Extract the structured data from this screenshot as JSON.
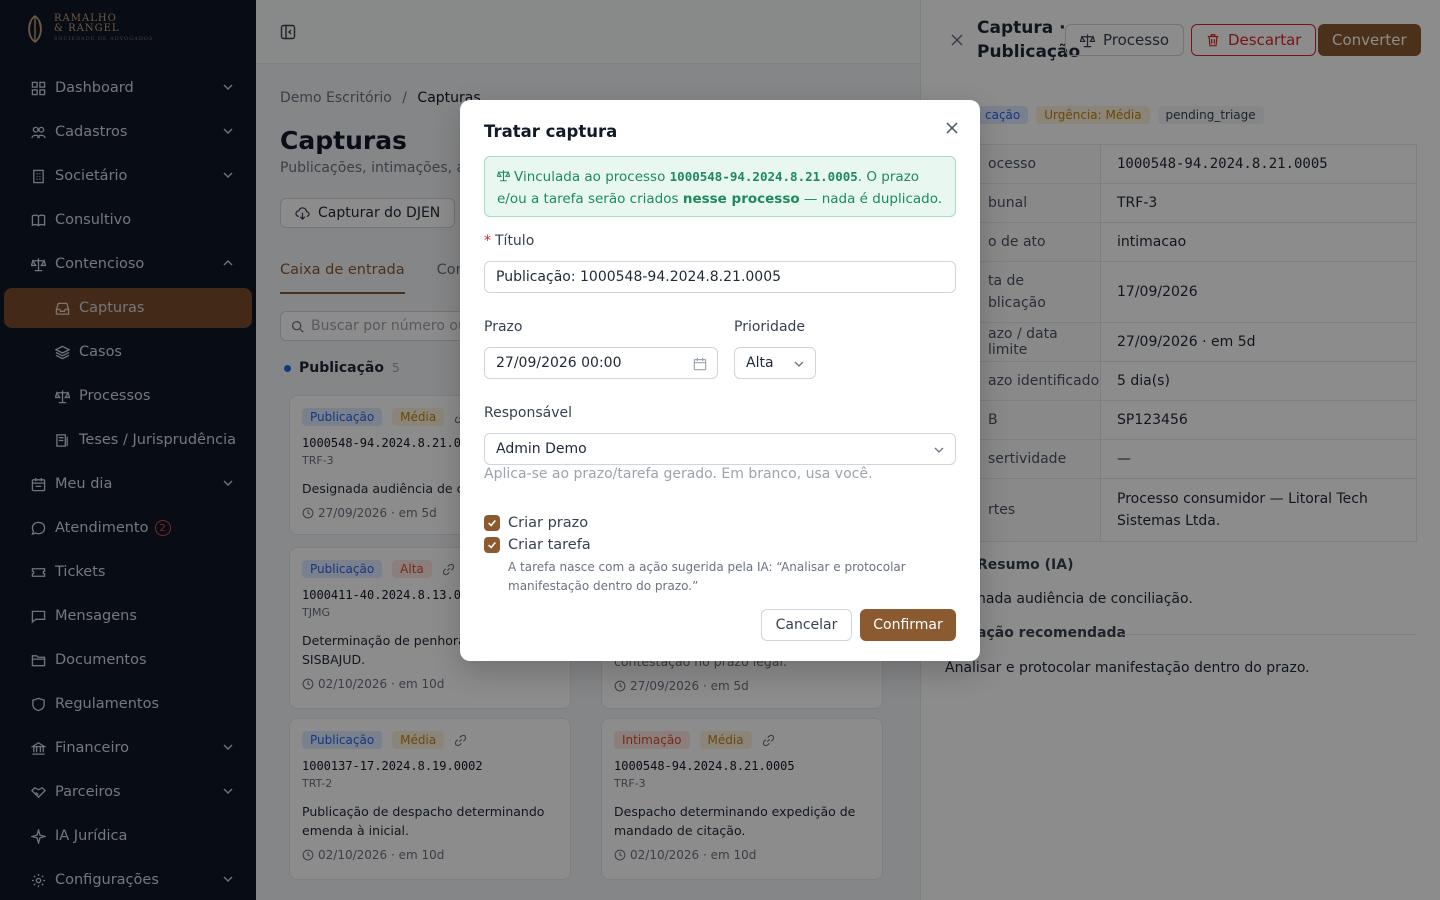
{
  "brand": {
    "name_line1": "RAMALHO",
    "name_line2": "& RANGEL",
    "tagline": "SOCIEDADE DE ADVOGADOS",
    "accent": "#8b5a30"
  },
  "sidebar": {
    "items": [
      {
        "label": "Dashboard",
        "icon": "grid-icon"
      },
      {
        "label": "Cadastros",
        "icon": "users-icon"
      },
      {
        "label": "Societário",
        "icon": "building-icon"
      },
      {
        "label": "Consultivo",
        "icon": "book-icon"
      },
      {
        "label": "Contencioso",
        "icon": "scale-icon"
      },
      {
        "label": "Capturas",
        "icon": "inbox-icon"
      },
      {
        "label": "Casos",
        "icon": "layers-icon"
      },
      {
        "label": "Processos",
        "icon": "scale-icon"
      },
      {
        "label": "Teses / Jurisprudência",
        "icon": "library-icon"
      },
      {
        "label": "Meu dia",
        "icon": "calendar-icon"
      },
      {
        "label": "Atendimento",
        "icon": "chat-icon",
        "badge": "2"
      },
      {
        "label": "Tickets",
        "icon": "ticket-icon"
      },
      {
        "label": "Mensagens",
        "icon": "message-icon"
      },
      {
        "label": "Documentos",
        "icon": "folder-icon"
      },
      {
        "label": "Regulamentos",
        "icon": "shield-icon"
      },
      {
        "label": "Financeiro",
        "icon": "bank-icon"
      },
      {
        "label": "Parceiros",
        "icon": "handshake-icon"
      },
      {
        "label": "IA Jurídica",
        "icon": "sparkle-icon"
      },
      {
        "label": "Configurações",
        "icon": "gear-icon"
      }
    ]
  },
  "main": {
    "breadcrumb": {
      "root": "Demo Escritório",
      "sep": "/",
      "current": "Capturas"
    },
    "title": "Capturas",
    "subtitle": "Publicações, intimações, ar",
    "capture_button": "Capturar do DJEN",
    "tabs": [
      {
        "label": "Caixa de entrada"
      },
      {
        "label": "Conf"
      }
    ],
    "search_placeholder": "Buscar por número ou",
    "group": {
      "label": "Publicação",
      "count": "5"
    },
    "cards": [
      {
        "type": "Publicação",
        "urgency": "Média",
        "number": "1000548-94.2024.8.21.0",
        "court": "TRF-3",
        "desc": "Designada audiência de co",
        "due": "27/09/2026 · em 5d"
      },
      {
        "type": "Publicação",
        "urgency": "Alta",
        "number": "1000411-40.2024.8.13.0",
        "court": "TJMG",
        "desc": "Determinação de penhora",
        "desc2": "SISBAJUD.",
        "due": "02/10/2026 · em 10d"
      },
      {
        "type": "Publicação",
        "urgency": "Média",
        "number": "1000137-17.2024.8.19.0002",
        "court": "TRT-2",
        "desc": "Publicação de despacho determinando",
        "desc2": "emenda à inicial.",
        "due": "02/10/2026 · em 10d"
      },
      {
        "type": "Intimação",
        "urgency": "Média",
        "number": "1000548-94.2024.8.21.0005",
        "court": "TRF-3",
        "desc": "Despacho determinando expedição de",
        "desc2": "mandado de citação.",
        "due": "02/10/2026 · em 10d"
      }
    ],
    "card_partial": {
      "desc": "contestação no prazo legal.",
      "due": "27/09/2026 · em 5d"
    }
  },
  "panel": {
    "title": "Captura · Publicação",
    "btn_process": "Processo",
    "btn_discard": "Descartar",
    "btn_convert": "Converter",
    "tags": [
      "cação",
      "Urgência: Média",
      "pending_triage"
    ],
    "rows": [
      {
        "k": "ocesso",
        "v": "1000548-94.2024.8.21.0005"
      },
      {
        "k": "bunal",
        "v": "TRF-3"
      },
      {
        "k": "o de ato",
        "v": "intimacao"
      },
      {
        "k": "ta de",
        "k2": "blicação",
        "v": "17/09/2026"
      },
      {
        "k": "azo / data limite",
        "v": "27/09/2026 · em 5d"
      },
      {
        "k": "azo identificado",
        "v": "5 dia(s)"
      },
      {
        "k": "B",
        "v": "SP123456"
      },
      {
        "k": "sertividade",
        "v": "—"
      },
      {
        "k": "rtes",
        "v": "Processo consumidor — Litoral Tech",
        "v2": "Sistemas Ltda."
      }
    ],
    "summary_heading": "Resumo (IA)",
    "summary_text": "nada audiência de conciliação.",
    "action_heading": "ação recomendada",
    "action_text": "Analisar e protocolar manifestação dentro do prazo."
  },
  "modal": {
    "title": "Tratar captura",
    "alert": {
      "prefix": "Vinculada ao processo ",
      "process": "1000548-94.2024.8.21.0005",
      "mid": ". O prazo",
      "line2_start": "e/ou a tarefa serão criados ",
      "bold": "nesse processo",
      "end": " — nada é duplicado."
    },
    "titulo_label": "Título",
    "titulo_value": "Publicação: 1000548-94.2024.8.21.0005",
    "prazo_label": "Prazo",
    "prazo_value": "27/09/2026 00:00",
    "prioridade_label": "Prioridade",
    "prioridade_value": "Alta",
    "responsavel_label": "Responsável",
    "responsavel_value": "Admin Demo",
    "responsavel_help": "Aplica-se ao prazo/tarefa gerado. Em branco, usa você.",
    "criar_prazo": "Criar prazo",
    "criar_tarefa": "Criar tarefa",
    "note_line1": "A tarefa nasce com a ação sugerida pela IA: “Analisar e protocolar",
    "note_line2": "manifestação dentro do prazo.”",
    "cancel": "Cancelar",
    "confirm": "Confirmar"
  }
}
